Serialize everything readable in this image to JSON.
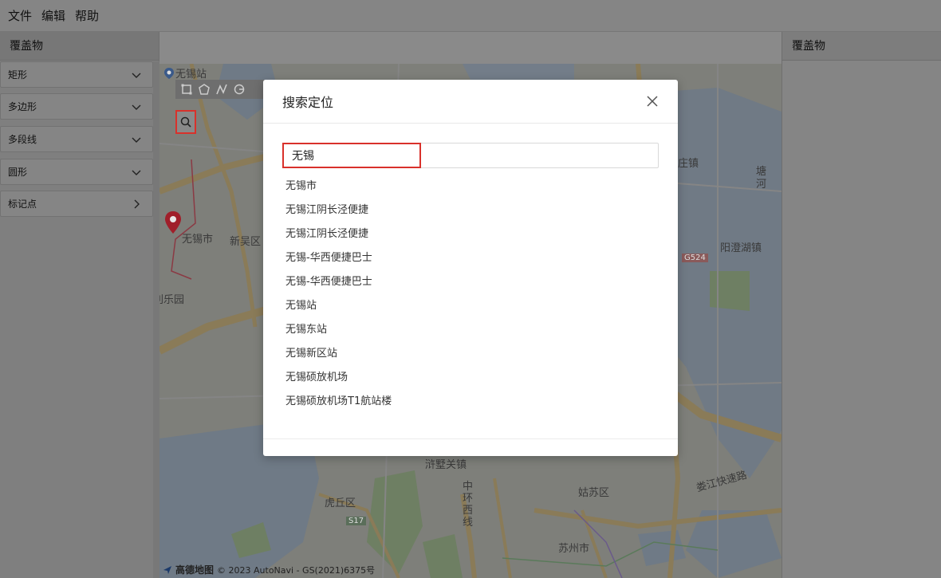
{
  "menu": {
    "items": [
      "文件",
      "编辑",
      "帮助"
    ]
  },
  "left_panel": {
    "title": "覆盖物",
    "items": [
      {
        "label": "矩形",
        "expanded": true
      },
      {
        "label": "多边形",
        "expanded": true
      },
      {
        "label": "多段线",
        "expanded": true
      },
      {
        "label": "圆形",
        "expanded": true
      },
      {
        "label": "标记点",
        "expanded": false
      }
    ]
  },
  "right_panel": {
    "title": "覆盖物"
  },
  "map": {
    "labels": {
      "station_wuxi": "无锡站",
      "city_wuxi": "无锡市",
      "xinwu": "新吴区",
      "lile": "利乐园",
      "yangcheng": "阳澄湖镇",
      "tanghe": "塘河",
      "huqiu": "虎丘区",
      "gusu": "姑苏区",
      "suzhou": "苏州市",
      "jishuguan": "浒墅关镇",
      "zhonghuan": "中环西线",
      "loujiang": "娄江快速路",
      "s17": "S17",
      "g524": "G524",
      "zhen": "庄镇"
    },
    "attribution": {
      "brand": "高德地图",
      "text": "© 2023 AutoNavi - GS(2021)6375号"
    }
  },
  "modal": {
    "title": "搜索定位",
    "search_value": "无锡",
    "results": [
      "无锡市",
      "无锡江阴长泾便捷",
      "无锡江阴长泾便捷",
      "无锡-华西便捷巴士",
      "无锡-华西便捷巴士",
      "无锡站",
      "无锡东站",
      "无锡新区站",
      "无锡硕放机场",
      "无锡硕放机场T1航站楼"
    ]
  },
  "colors": {
    "accent_red": "#d9312b",
    "marker": "#c8202f"
  }
}
